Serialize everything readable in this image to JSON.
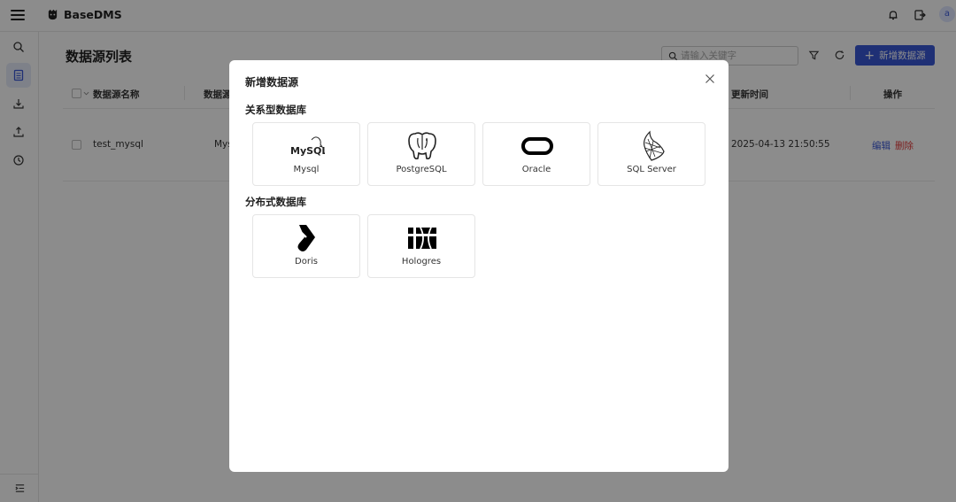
{
  "app": {
    "name": "BaseDMS",
    "avatar_letter": "a"
  },
  "sidebar": {
    "items": [
      {
        "name": "search",
        "icon": "search-icon"
      },
      {
        "name": "datasource-list",
        "icon": "list-icon",
        "active": true
      },
      {
        "name": "import",
        "icon": "download-icon"
      },
      {
        "name": "export",
        "icon": "upload-icon"
      },
      {
        "name": "history",
        "icon": "history-icon"
      }
    ],
    "bottom_icon": "collapse-menu-icon"
  },
  "page": {
    "title": "数据源列表",
    "search_placeholder": "请输入关键字",
    "add_button": "新增数据源"
  },
  "table": {
    "columns": [
      "数据源名称",
      "数据源",
      "更新时间",
      "操作"
    ],
    "rows": [
      {
        "name": "test_mysql",
        "type": "Mys",
        "updated": "2025-04-13 21:50:55",
        "edit": "编辑",
        "delete": "删除"
      }
    ]
  },
  "modal": {
    "title": "新增数据源",
    "sections": [
      {
        "title": "关系型数据库",
        "items": [
          {
            "label": "Mysql",
            "logo_text": "MySQL"
          },
          {
            "label": "PostgreSQL"
          },
          {
            "label": "Oracle"
          },
          {
            "label": "SQL Server"
          }
        ]
      },
      {
        "title": "分布式数据库",
        "items": [
          {
            "label": "Doris"
          },
          {
            "label": "Hologres"
          }
        ]
      }
    ]
  },
  "colors": {
    "primary": "#3a58d6",
    "danger": "#e23b3b",
    "active_bg": "#e6ebfa"
  }
}
